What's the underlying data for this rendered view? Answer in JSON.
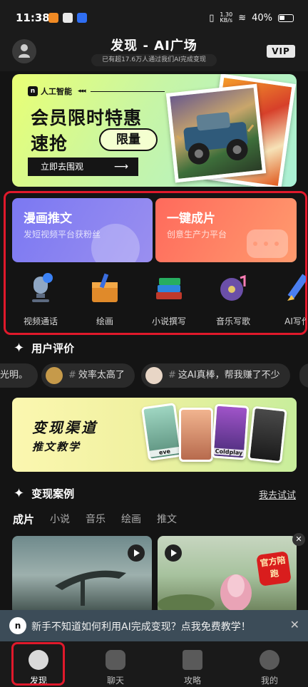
{
  "status": {
    "time": "11:38",
    "net_speed": "1.30\nKB/s",
    "battery": "40%"
  },
  "header": {
    "title": "发现 - AI广场",
    "subtitle": "已有超17.6万人通过我们AI完成变现",
    "vip": "VIP"
  },
  "banner": {
    "tag": "人工智能",
    "line1": "会员限时特惠",
    "line2": "速抢",
    "pill": "限量",
    "cta": "立即去围观",
    "cta_arrow": "⟶"
  },
  "cards": [
    {
      "title": "漫画推文",
      "subtitle": "发短视频平台获粉丝",
      "color": "#8582f1"
    },
    {
      "title": "一键成片",
      "subtitle": "创意生产力平台",
      "color": "#ff7a62"
    }
  ],
  "tools": [
    {
      "label": "视频通话",
      "icon": "microphone-icon"
    },
    {
      "label": "绘画",
      "icon": "paint-box-icon"
    },
    {
      "label": "小说撰写",
      "icon": "books-icon"
    },
    {
      "label": "音乐写歌",
      "icon": "music-icon"
    },
    {
      "label": "AI写作",
      "icon": "pencil-icon"
    }
  ],
  "reviews": {
    "title": "用户评价",
    "items": [
      {
        "text": "光明。"
      },
      {
        "hash": "#",
        "text": "效率太高了"
      },
      {
        "hash": "#",
        "text": "这AI真棒，帮我赚了不少"
      }
    ]
  },
  "promo": {
    "line1": "变现渠道",
    "line2": "推文教学",
    "names": [
      "eve",
      "",
      "Coldplay",
      ""
    ]
  },
  "cases": {
    "title": "变现案例",
    "more": "我去试试",
    "tabs": [
      "成片",
      "小说",
      "音乐",
      "绘画",
      "推文"
    ],
    "badge": "官方陪跑"
  },
  "notice": {
    "logo": "n",
    "text": "新手不知道如何利用AI完成变现？点我免费教学！",
    "close": "✕"
  },
  "nav": [
    {
      "label": "发现"
    },
    {
      "label": "聊天"
    },
    {
      "label": "攻略"
    },
    {
      "label": "我的"
    }
  ],
  "colors": {
    "accent_red": "#e0192b",
    "background": "#141414",
    "banner_green": "#d8ff7a"
  }
}
